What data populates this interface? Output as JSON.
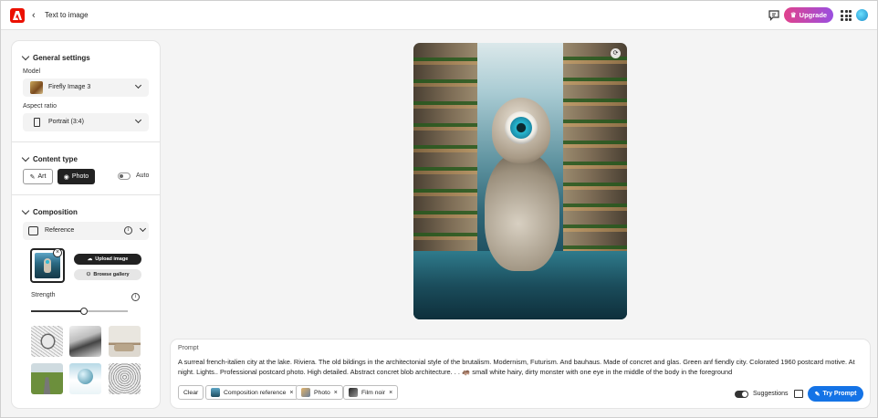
{
  "header": {
    "title": "Text to image",
    "upgrade_label": "Upgrade"
  },
  "panel": {
    "general": {
      "heading": "General settings",
      "model_label": "Model",
      "model_value": "Firefly Image 3",
      "aspect_label": "Aspect ratio",
      "aspect_value": "Portrait (3:4)"
    },
    "content_type": {
      "heading": "Content type",
      "options": [
        "Art",
        "Photo"
      ],
      "selected": "Photo",
      "auto_label": "Auto",
      "auto_on": false
    },
    "composition": {
      "heading": "Composition",
      "reference_label": "Reference",
      "upload_label": "Upload image",
      "gallery_label": "Browse gallery",
      "strength_label": "Strength",
      "strength_value": 0.55
    }
  },
  "prompt": {
    "label": "Prompt",
    "text": "A surreal french-italien city at the lake. Riviera. The old bildings in the architectonial style of the brutalism. Modernism, Futurism. And bauhaus. Made of concret and glas. Green anf fiendly city. Colorated 1960 postcard motive. At night. Lights.. Professional postcard photo. High detailed. Abstract concret blob architecture. . . 🦛 small white hairy, dirty monster with one eye in the middle of the body in the foreground",
    "clear_label": "Clear",
    "chips": [
      {
        "label": "Composition reference"
      },
      {
        "label": "Photo"
      },
      {
        "label": "Film noir"
      }
    ],
    "suggestions_label": "Suggestions",
    "suggestions_on": true,
    "try_label": "Try Prompt"
  },
  "colors": {
    "accent": "#1473e6",
    "brand": "#eb1000"
  }
}
